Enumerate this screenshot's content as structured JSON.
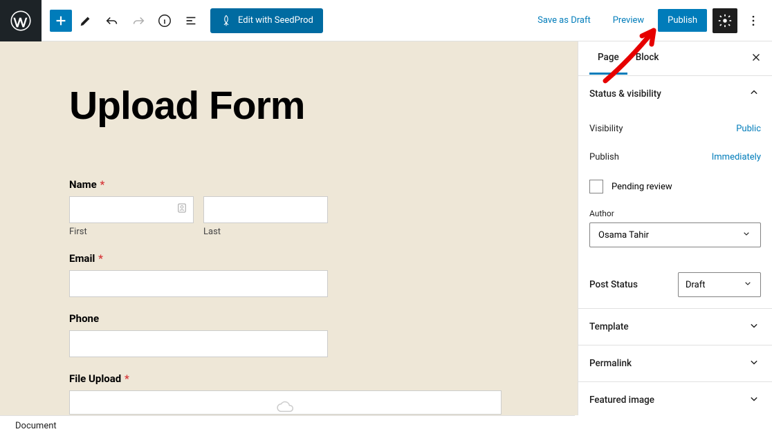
{
  "toolbar": {
    "seedprod_label": "Edit with SeedProd",
    "save_draft_label": "Save as Draft",
    "preview_label": "Preview",
    "publish_label": "Publish"
  },
  "canvas": {
    "page_title": "Upload Form",
    "fields": {
      "name": {
        "label": "Name",
        "required": true,
        "first_sub": "First",
        "last_sub": "Last"
      },
      "email": {
        "label": "Email",
        "required": true
      },
      "phone": {
        "label": "Phone",
        "required": false
      },
      "file_upload": {
        "label": "File Upload",
        "required": true
      }
    }
  },
  "sidebar": {
    "tabs": {
      "page": "Page",
      "block": "Block"
    },
    "panels": {
      "status_visibility": {
        "title": "Status & visibility",
        "visibility_label": "Visibility",
        "visibility_value": "Public",
        "publish_label": "Publish",
        "publish_value": "Immediately",
        "pending_review": "Pending review",
        "author_label": "Author",
        "author_value": "Osama Tahir",
        "post_status_label": "Post Status",
        "post_status_value": "Draft"
      },
      "template": "Template",
      "permalink": "Permalink",
      "featured_image": "Featured image"
    }
  },
  "footer": {
    "breadcrumb": "Document"
  }
}
